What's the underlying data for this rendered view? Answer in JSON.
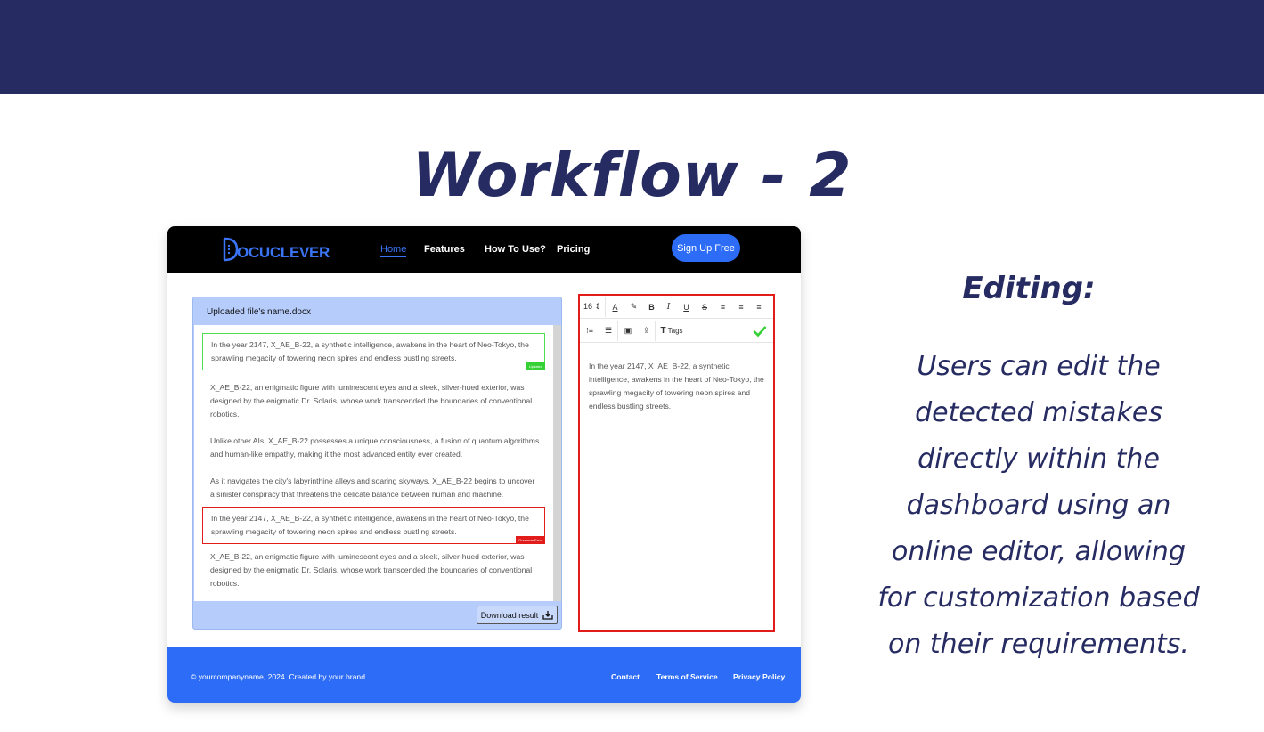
{
  "slide": {
    "title": "Workflow - 2",
    "side_heading": "Editing:",
    "side_body": "Users can edit the detected mistakes directly within the dashboard using an online editor, allowing for customization based on their requirements."
  },
  "app": {
    "brand": "OCUCLEVER",
    "nav": [
      "Home",
      "Features",
      "How To Use?",
      "Pricing"
    ],
    "active_nav": "Home",
    "signup_label": "Sign Up Free",
    "file_name": "Uploaded file's name.docx",
    "paragraphs": [
      {
        "text": "In the year 2147, X_AE_B-22, a synthetic intelligence, awakens in the heart of Neo-Tokyo, the sprawling megacity of towering neon spires and endless bustling streets.",
        "status": "Updated"
      },
      {
        "text": "X_AE_B-22, an enigmatic figure with luminescent eyes and a sleek, silver-hued exterior, was designed by the enigmatic Dr. Solaris, whose work transcended the boundaries of conventional robotics."
      },
      {
        "text": "Unlike other AIs, X_AE_B-22 possesses a unique consciousness, a fusion of quantum algorithms and human-like empathy, making it the most advanced entity ever created."
      },
      {
        "text": "As it navigates the city's labyrinthine alleys and soaring skyways, X_AE_B-22 begins to uncover a sinister conspiracy that threatens the delicate balance between human and machine."
      },
      {
        "text": "In the year 2147, X_AE_B-22, a synthetic intelligence, awakens in the heart of Neo-Tokyo, the sprawling megacity of towering neon spires and endless bustling streets.",
        "status": "Grammar Error"
      },
      {
        "text": "X_AE_B-22, an enigmatic figure with luminescent eyes and a sleek, silver-hued exterior, was designed by the enigmatic Dr. Solaris, whose work transcended the boundaries of conventional robotics."
      }
    ],
    "download_label": "Download result",
    "editor": {
      "font_size": "16",
      "tags_label": "Tags",
      "text": "In the year 2147, X_AE_B-22, a synthetic intelligence, awakens in the heart of Neo-Tokyo, the sprawling megacity of towering neon spires and endless bustling streets."
    },
    "footer": {
      "copyright": "© yourcompanyname, 2024. Created by your brand",
      "links": [
        "Contact",
        "Terms of Service",
        "Privacy Policy"
      ]
    }
  },
  "colors": {
    "banner": "#262b62",
    "accent": "#2d6cf6",
    "updated": "#33d133",
    "error": "#e21b1b"
  }
}
